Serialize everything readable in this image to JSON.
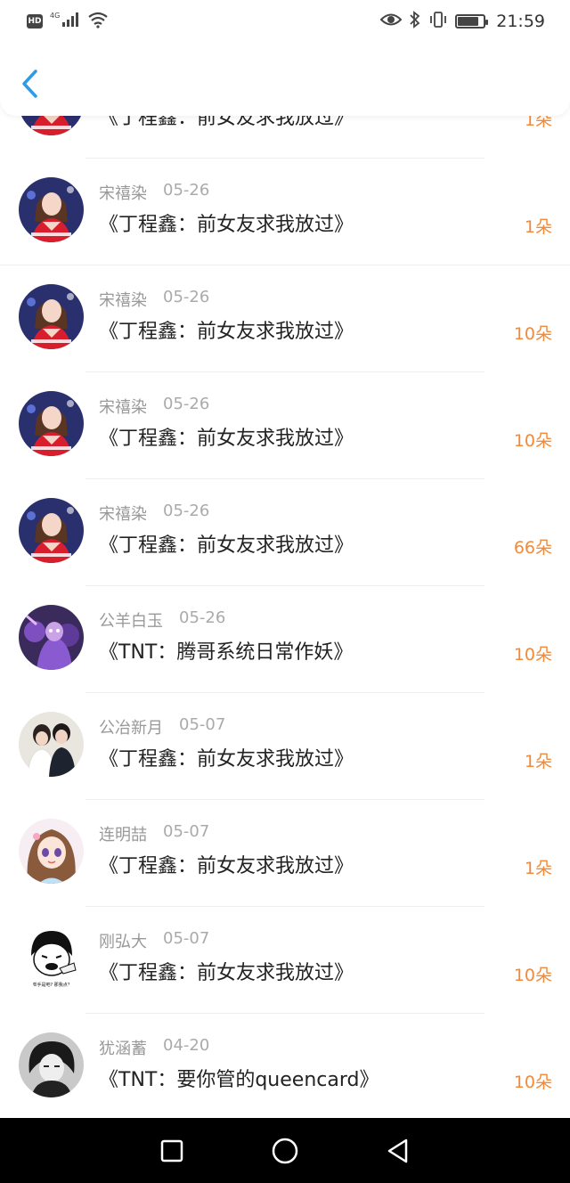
{
  "status_bar": {
    "hd": "HD",
    "network": "4G",
    "time": "21:59",
    "battery_level": 0.8
  },
  "header": {
    "back_icon": "chevron-left-icon",
    "accent": "#2f9ae6"
  },
  "colors": {
    "amount": "#f08a3c",
    "meta": "#999999"
  },
  "rows": [
    {
      "name": "",
      "date": "",
      "title": "《丁程鑫：前女友求我放过》",
      "amount": "1朵",
      "avatar": "red-dress-portrait"
    },
    {
      "name": "宋禧染",
      "date": "05-26",
      "title": "《丁程鑫：前女友求我放过》",
      "amount": "1朵",
      "avatar": "red-dress-portrait"
    },
    {
      "name": "宋禧染",
      "date": "05-26",
      "title": "《丁程鑫：前女友求我放过》",
      "amount": "10朵",
      "avatar": "red-dress-portrait"
    },
    {
      "name": "宋禧染",
      "date": "05-26",
      "title": "《丁程鑫：前女友求我放过》",
      "amount": "10朵",
      "avatar": "red-dress-portrait"
    },
    {
      "name": "宋禧染",
      "date": "05-26",
      "title": "《丁程鑫：前女友求我放过》",
      "amount": "66朵",
      "avatar": "red-dress-portrait"
    },
    {
      "name": "公羊白玉",
      "date": "05-26",
      "title": "《TNT：腾哥系统日常作妖》",
      "amount": "10朵",
      "avatar": "purple-character"
    },
    {
      "name": "公冶新月",
      "date": "05-07",
      "title": "《丁程鑫：前女友求我放过》",
      "amount": "1朵",
      "avatar": "couple-photo"
    },
    {
      "name": "连明喆",
      "date": "05-07",
      "title": "《丁程鑫：前女友求我放过》",
      "amount": "1朵",
      "avatar": "anime-girl"
    },
    {
      "name": "刚弘大",
      "date": "05-07",
      "title": "《丁程鑫：前女友求我放过》",
      "amount": "10朵",
      "avatar": "meme-face"
    },
    {
      "name": "犹涵蓄",
      "date": "04-20",
      "title": "《TNT：要你管的queencard》",
      "amount": "10朵",
      "avatar": "dark-anime-boy"
    }
  ],
  "meme_caption": "单手是吧? 那我点?",
  "nav_bar": {
    "recent_icon": "square-icon",
    "home_icon": "circle-icon",
    "back_icon": "triangle-back-icon"
  }
}
